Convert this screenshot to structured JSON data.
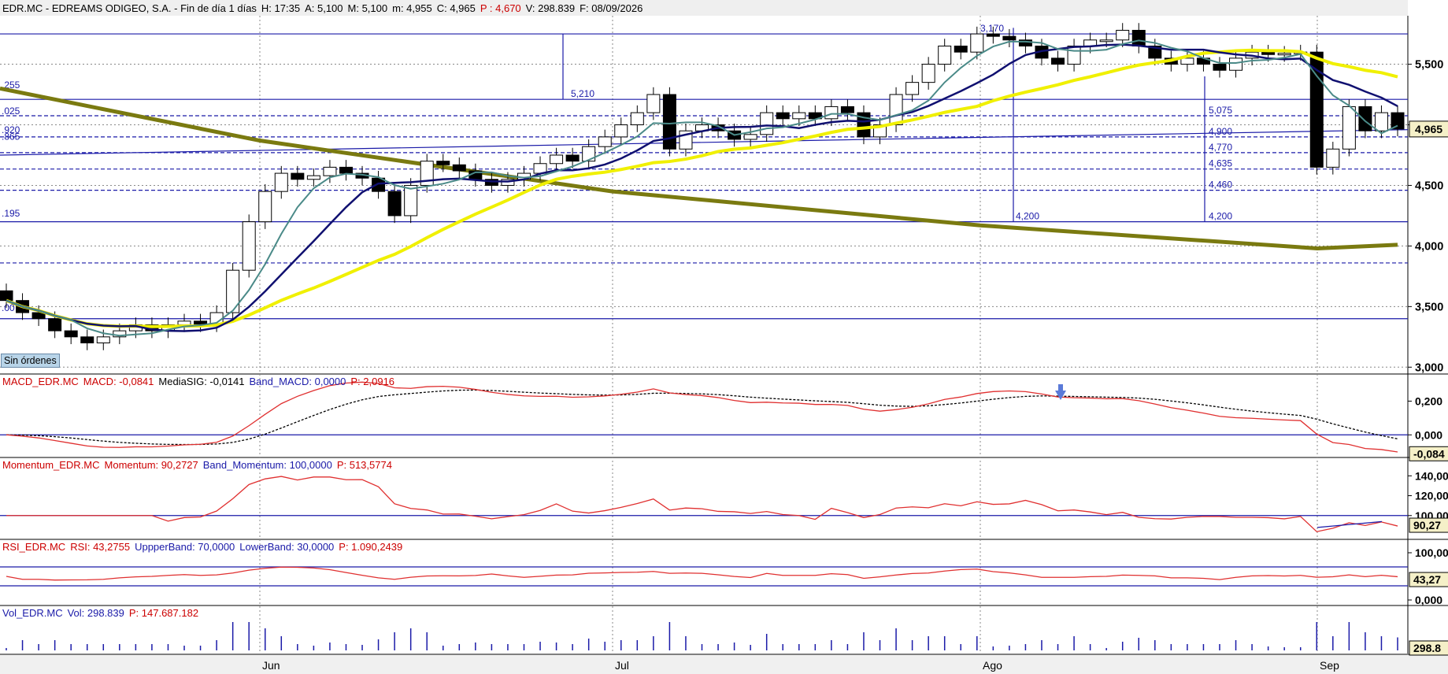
{
  "header": {
    "symbol": "EDR.MC - EDREAMS ODIGEO, S.A. - Fin de día 1 días",
    "h": "H: 17:35",
    "a": "A: 5,100",
    "m": "M: 5,100",
    "mn": "m: 4,955",
    "c": "C: 4,965",
    "p": "P : 4,670",
    "v": "V: 298.839",
    "f": "F: 08/09/2026"
  },
  "sin_ordenes": "Sin órdenes",
  "panels": {
    "macd": {
      "name": "MACD_EDR.MC",
      "label1": "MACD: -0,0841",
      "label2": "MediaSIG: -0,0141",
      "label3": "Band_MACD: 0,0000",
      "label4": "P: 2,0916"
    },
    "momentum": {
      "name": "Momentum_EDR.MC",
      "label1": "Momentum: 90,2727",
      "label2": "Band_Momentum: 100,0000",
      "label3": "P: 513,5774"
    },
    "rsi": {
      "name": "RSI_EDR.MC",
      "label1": "RSI: 43,2755",
      "label2": "UppperBand: 70,0000",
      "label3": "LowerBand: 30,0000",
      "label4": "P: 1.090,2439"
    },
    "vol": {
      "name": "Vol_EDR.MC",
      "label1": "Vol: 298.839",
      "label2": "P: 147.687.182"
    }
  },
  "colors": {
    "grid": "#888888",
    "level": "#1a1aa8",
    "price_lines": "#1a1aa8",
    "ma_fast": "#4a8a88",
    "ma_slow": "#101070",
    "ma_yellow": "#f0f000",
    "trend_olive": "#7a7a10",
    "indicator_red": "#e03030",
    "signal_black": "#000000",
    "current_box": "#f5f0c8"
  },
  "chart_data": {
    "type": "candlestick",
    "x_labels": [
      "Jun",
      "Jul",
      "Ago",
      "Sep"
    ],
    "y_ticks": [
      "5,500",
      "5,000",
      "4,500",
      "4,000",
      "3,500",
      "3,000"
    ],
    "y_range": [
      2950,
      5900
    ],
    "current_price_label": "4,965",
    "level_labels": [
      {
        "text": "5,210",
        "value": 5210
      },
      {
        "text": "5,075",
        "value": 5075
      },
      {
        "text": "4,900",
        "value": 4900
      },
      {
        "text": "4,770",
        "value": 4770
      },
      {
        "text": "4,635",
        "value": 4635
      },
      {
        "text": "4,460",
        "value": 4460
      },
      {
        "text": "4,200",
        "value": 4200
      },
      {
        "text": "3,170",
        "value": 5750
      },
      {
        "text": "4,200",
        "value": 4200
      }
    ],
    "left_edge_labels": [
      ".255",
      ".025",
      ".920",
      ".865",
      ".195",
      ".00"
    ],
    "series": [
      {
        "name": "price",
        "ohlc_close": [
          3550,
          3450,
          3400,
          3300,
          3250,
          3200,
          3250,
          3300,
          3350,
          3300,
          3350,
          3380,
          3350,
          3450,
          3800,
          4200,
          4450,
          4600,
          4550,
          4580,
          4650,
          4600,
          4560,
          4450,
          4250,
          4500,
          4700,
          4670,
          4620,
          4550,
          4500,
          4550,
          4600,
          4680,
          4750,
          4700,
          4820,
          4900,
          5000,
          5100,
          5250,
          4800,
          4950,
          5000,
          4950,
          4880,
          4920,
          5100,
          5050,
          5100,
          5050,
          5150,
          5100,
          4900,
          5000,
          5250,
          5350,
          5500,
          5650,
          5600,
          5750,
          5730,
          5700,
          5650,
          5550,
          5500,
          5650,
          5700,
          5700,
          5780,
          5650,
          5550,
          5500,
          5550,
          5500,
          5450,
          5550,
          5600,
          5580,
          5590,
          5600,
          4650,
          4800,
          5150,
          4950,
          5100,
          4965
        ]
      }
    ],
    "indicators": {
      "macd": {
        "value": -0.0841,
        "signal": -0.0141,
        "band": 0.0,
        "y_ticks": [
          "0,200",
          "0,000"
        ],
        "current_label": "-0,084"
      },
      "momentum": {
        "value": 90.2727,
        "band": 100.0,
        "y_ticks": [
          "140,00",
          "120,00",
          "100,00"
        ],
        "current_label": "90,27"
      },
      "rsi": {
        "value": 43.2755,
        "upper": 70.0,
        "lower": 30.0,
        "y_ticks": [
          "100,00",
          "0,000"
        ],
        "current_label": "43,27"
      },
      "vol": {
        "value": 298839,
        "current_label": "298.8"
      }
    }
  }
}
